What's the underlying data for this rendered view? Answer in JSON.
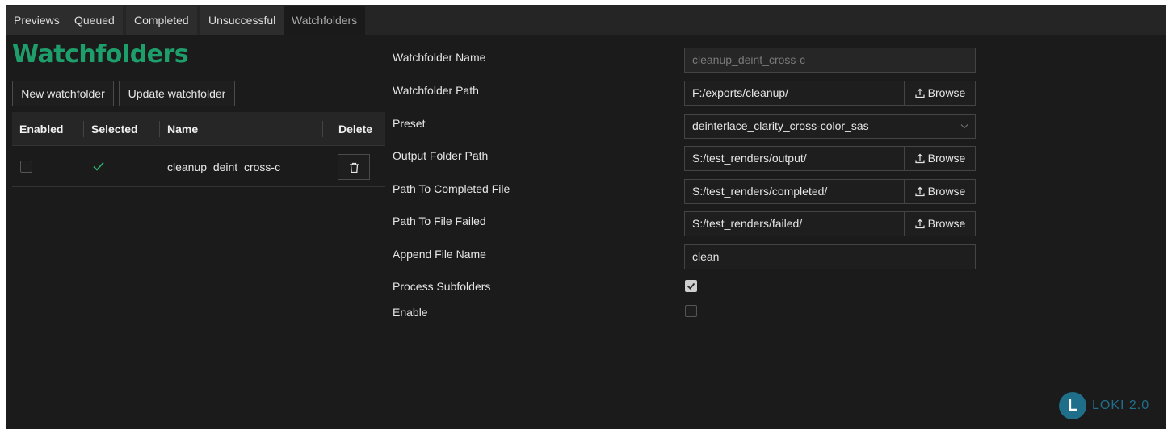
{
  "tabs": [
    {
      "label": "Previews"
    },
    {
      "label": "Queued"
    },
    {
      "label": "Completed"
    },
    {
      "label": "Unsuccessful"
    },
    {
      "label": "Watchfolders",
      "active": true
    }
  ],
  "page": {
    "title": "Watchfolders",
    "new_button": "New watchfolder",
    "update_button": "Update watchfolder"
  },
  "table": {
    "columns": [
      "Enabled",
      "Selected",
      "Name",
      "Delete"
    ],
    "rows": [
      {
        "enabled": false,
        "selected": true,
        "name": "cleanup_deint_cross-c"
      }
    ]
  },
  "form": {
    "name_label": "Watchfolder Name",
    "name_value": "cleanup_deint_cross-c",
    "path_label": "Watchfolder Path",
    "path_value": "F:/exports/cleanup/",
    "preset_label": "Preset",
    "preset_value": "deinterlace_clarity_cross-color_sas",
    "output_label": "Output Folder Path",
    "output_value": "S:/test_renders/output/",
    "completed_label": "Path To Completed File",
    "completed_value": "S:/test_renders/completed/",
    "failed_label": "Path To File Failed",
    "failed_value": "S:/test_renders/failed/",
    "append_label": "Append File Name",
    "append_value": "clean",
    "subfolders_label": "Process Subfolders",
    "subfolders_checked": true,
    "enable_label": "Enable",
    "enable_checked": false,
    "browse_label": "Browse"
  },
  "brand": {
    "logo_letter": "L",
    "logo_text": "LOKI 2.0"
  },
  "colors": {
    "accent_green": "#1e9e6a",
    "logo_blue": "#1f6f8b",
    "background": "#1b1b1b"
  },
  "icons": {
    "delete": "trash-icon",
    "browse": "upload-icon",
    "preset": "chevron-down-icon",
    "selected": "check-icon"
  }
}
